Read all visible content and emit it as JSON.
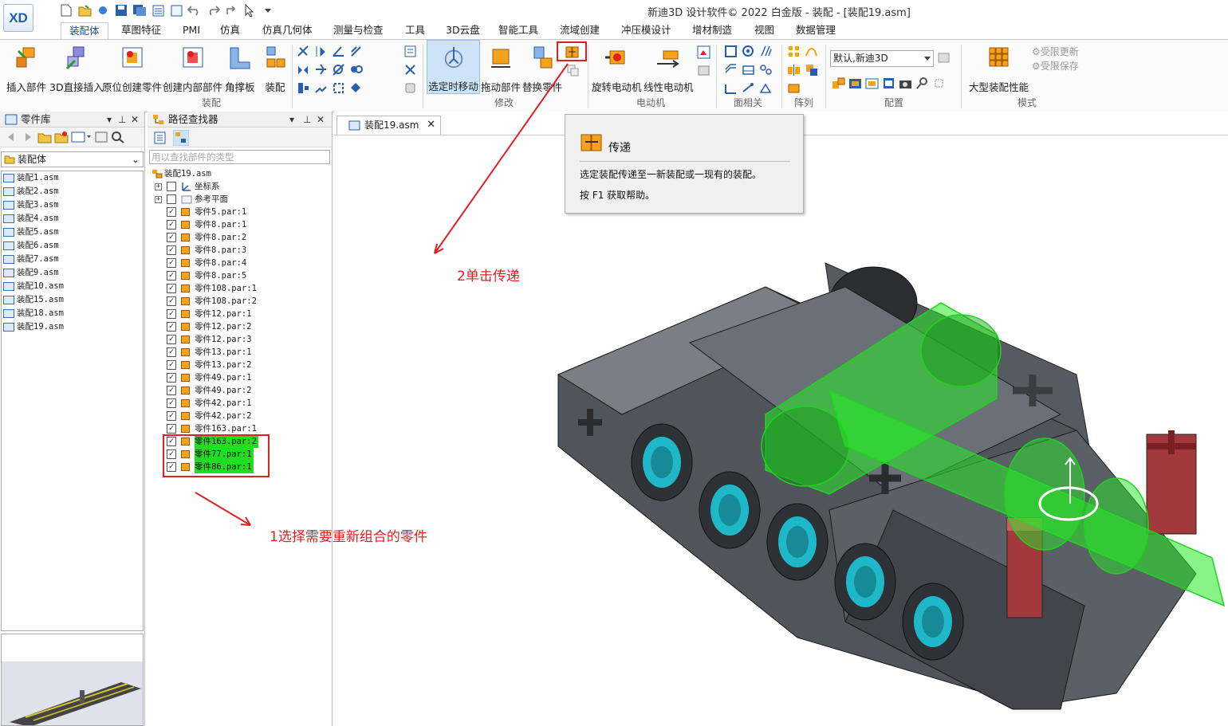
{
  "window": {
    "title": "新迪3D 设计软件© 2022 白金版 - 装配 - [装配19.asm]",
    "logo": "XD"
  },
  "tabs": [
    "装配体",
    "草图特征",
    "PMI",
    "仿真",
    "仿真几何体",
    "测量与检查",
    "工具",
    "3D云盘",
    "智能工具",
    "流域创建",
    "冲压模设计",
    "增材制造",
    "视图",
    "数据管理"
  ],
  "ribbon": {
    "assembly": {
      "label": "装配",
      "buttons": [
        "插入部件",
        "3D直接插入",
        "原位创建零件",
        "创建内部部件",
        "角撑板",
        "装配"
      ]
    },
    "modify": {
      "label": "修改",
      "buttons": [
        "选定时移动",
        "拖动部件",
        "替换零件"
      ]
    },
    "motor": {
      "label": "电动机",
      "buttons": [
        "旋转电动机",
        "线性电动机"
      ]
    },
    "face": {
      "label": "面相关"
    },
    "pattern": {
      "label": "阵列"
    },
    "config": {
      "label": "配置",
      "value": "默认,新迪3D"
    },
    "mode": {
      "label": "模式",
      "button": "大型装配性能",
      "limited_update": "受限更新",
      "limited_save": "受限保存"
    }
  },
  "part_library": {
    "title": "零件库",
    "folder": "装配体",
    "items": [
      "装配1.asm",
      "装配2.asm",
      "装配3.asm",
      "装配4.asm",
      "装配5.asm",
      "装配6.asm",
      "装配7.asm",
      "装配9.asm",
      "装配10.asm",
      "装配15.asm",
      "装配18.asm",
      "装配19.asm"
    ]
  },
  "pathfinder": {
    "title": "路径查找器",
    "search_placeholder": "用以查找部件的类型",
    "root": "装配19.asm",
    "groups": [
      "坐标系",
      "参考平面"
    ],
    "parts": [
      {
        "name": "零件5.par:1",
        "highlight": false
      },
      {
        "name": "零件8.par:1",
        "highlight": false
      },
      {
        "name": "零件8.par:2",
        "highlight": false
      },
      {
        "name": "零件8.par:3",
        "highlight": false
      },
      {
        "name": "零件8.par:4",
        "highlight": false
      },
      {
        "name": "零件8.par:5",
        "highlight": false
      },
      {
        "name": "零件108.par:1",
        "highlight": false
      },
      {
        "name": "零件108.par:2",
        "highlight": false
      },
      {
        "name": "零件12.par:1",
        "highlight": false
      },
      {
        "name": "零件12.par:2",
        "highlight": false
      },
      {
        "name": "零件12.par:3",
        "highlight": false
      },
      {
        "name": "零件13.par:1",
        "highlight": false
      },
      {
        "name": "零件13.par:2",
        "highlight": false
      },
      {
        "name": "零件49.par:1",
        "highlight": false
      },
      {
        "name": "零件49.par:2",
        "highlight": false
      },
      {
        "name": "零件42.par:1",
        "highlight": false
      },
      {
        "name": "零件42.par:2",
        "highlight": false
      },
      {
        "name": "零件163.par:1",
        "highlight": false
      },
      {
        "name": "零件163.par:2",
        "highlight": true
      },
      {
        "name": "零件77.par:1",
        "highlight": true
      },
      {
        "name": "零件86.par:1",
        "highlight": true
      }
    ]
  },
  "document_tab": {
    "label": "装配19.asm",
    "close": "✕"
  },
  "tooltip": {
    "title": "传递",
    "description": "选定装配传递至一新装配或一现有的装配。",
    "help": "按 F1 获取帮助。"
  },
  "annotations": {
    "step1": "1选择需要重新组合的零件",
    "step2": "2单击传递"
  },
  "colors": {
    "accent": "#1a4f93",
    "highlight": "#1fe01f",
    "annotation": "#e02020",
    "part_orange": "#f6a21c"
  },
  "icons": {
    "checkbox_checked": "☑",
    "check": "✓",
    "expander": "+",
    "pin": "📌",
    "close": "✕",
    "dropdown": "▾"
  }
}
